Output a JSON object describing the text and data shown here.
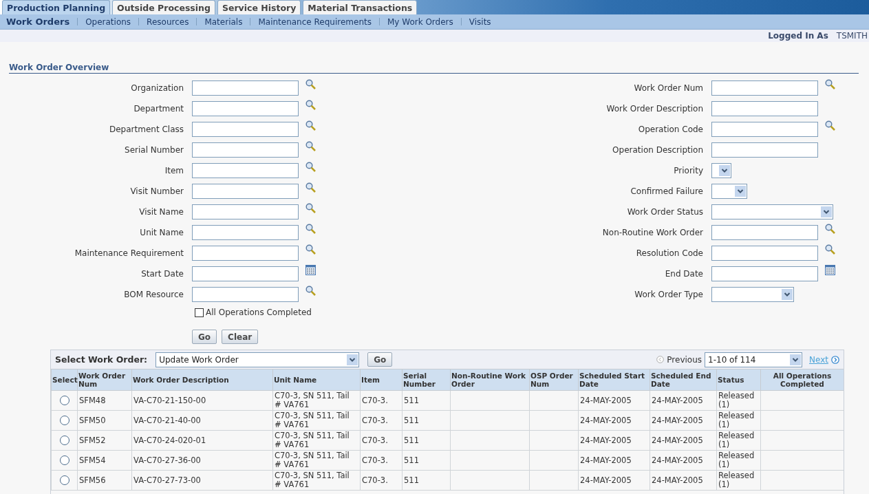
{
  "tabs": [
    {
      "label": "Production Planning",
      "selected": true
    },
    {
      "label": "Outside Processing",
      "selected": false
    },
    {
      "label": "Service History",
      "selected": false
    },
    {
      "label": "Material Transactions",
      "selected": false
    }
  ],
  "subnav": [
    {
      "label": "Work Orders",
      "selected": true
    },
    {
      "label": "Operations",
      "selected": false
    },
    {
      "label": "Resources",
      "selected": false
    },
    {
      "label": "Materials",
      "selected": false
    },
    {
      "label": "Maintenance Requirements",
      "selected": false
    },
    {
      "label": "My Work Orders",
      "selected": false
    },
    {
      "label": "Visits",
      "selected": false
    }
  ],
  "user": {
    "label": "Logged In As",
    "name": "TSMITH"
  },
  "section_title": "Work Order Overview",
  "left_fields": [
    {
      "label": "Organization",
      "kind": "lov"
    },
    {
      "label": "Department",
      "kind": "lov"
    },
    {
      "label": "Department Class",
      "kind": "lov"
    },
    {
      "label": "Serial Number",
      "kind": "lov"
    },
    {
      "label": "Item",
      "kind": "lov"
    },
    {
      "label": "Visit Number",
      "kind": "lov"
    },
    {
      "label": "Visit Name",
      "kind": "lov"
    },
    {
      "label": "Unit Name",
      "kind": "lov"
    },
    {
      "label": "Maintenance Requirement",
      "kind": "lov"
    },
    {
      "label": "Start Date",
      "kind": "date"
    },
    {
      "label": "BOM Resource",
      "kind": "lov"
    }
  ],
  "right_fields": [
    {
      "label": "Work Order Num",
      "kind": "lov"
    },
    {
      "label": "Work Order Description",
      "kind": "text"
    },
    {
      "label": "Operation Code",
      "kind": "lov"
    },
    {
      "label": "Operation Description",
      "kind": "text"
    },
    {
      "label": "Priority",
      "kind": "select"
    },
    {
      "label": "Confirmed Failure",
      "kind": "select"
    },
    {
      "label": "Work Order Status",
      "kind": "select"
    },
    {
      "label": "Non-Routine Work Order",
      "kind": "lov"
    },
    {
      "label": "Resolution Code",
      "kind": "lov"
    },
    {
      "label": "End Date",
      "kind": "date"
    },
    {
      "label": "Work Order Type",
      "kind": "select"
    }
  ],
  "all_ops_checkbox": {
    "label": "All Operations Completed",
    "checked": false
  },
  "buttons": [
    "Go",
    "Clear"
  ],
  "table": {
    "select_label": "Select Work Order:",
    "action": "Update Work Order",
    "action_button": "Go",
    "previous": "Previous",
    "range": "1-10 of 114",
    "next": "Next",
    "columns": [
      "Select",
      "Work Order Num",
      "Work Order Description",
      "Unit Name",
      "Item",
      "Serial Number",
      "Non-Routine Work Order",
      "OSP Order Num",
      "Scheduled Start Date",
      "Scheduled End Date",
      "Status",
      "All Operations Completed"
    ],
    "rows": [
      {
        "selected": false,
        "cells": [
          "",
          "SFM48",
          "VA-C70-21-150-00",
          "C70-3, SN 511, Tail # VA761",
          "C70-3.",
          "511",
          "",
          "",
          "24-MAY-2005",
          "24-MAY-2005",
          "Released (1)",
          ""
        ]
      },
      {
        "selected": false,
        "cells": [
          "",
          "SFM50",
          "VA-C70-21-40-00",
          "C70-3, SN 511, Tail # VA761",
          "C70-3.",
          "511",
          "",
          "",
          "24-MAY-2005",
          "24-MAY-2005",
          "Released (1)",
          ""
        ]
      },
      {
        "selected": false,
        "cells": [
          "",
          "SFM52",
          "VA-C70-24-020-01",
          "C70-3, SN 511, Tail # VA761",
          "C70-3.",
          "511",
          "",
          "",
          "24-MAY-2005",
          "24-MAY-2005",
          "Released (1)",
          ""
        ]
      },
      {
        "selected": false,
        "cells": [
          "",
          "SFM54",
          "VA-C70-27-36-00",
          "C70-3, SN 511, Tail # VA761",
          "C70-3.",
          "511",
          "",
          "",
          "24-MAY-2005",
          "24-MAY-2005",
          "Released (1)",
          ""
        ]
      },
      {
        "selected": false,
        "cells": [
          "",
          "SFM56",
          "VA-C70-27-73-00",
          "C70-3, SN 511, Tail # VA761",
          "C70-3.",
          "511",
          "",
          "",
          "24-MAY-2005",
          "24-MAY-2005",
          "Released (1)",
          ""
        ]
      }
    ]
  }
}
